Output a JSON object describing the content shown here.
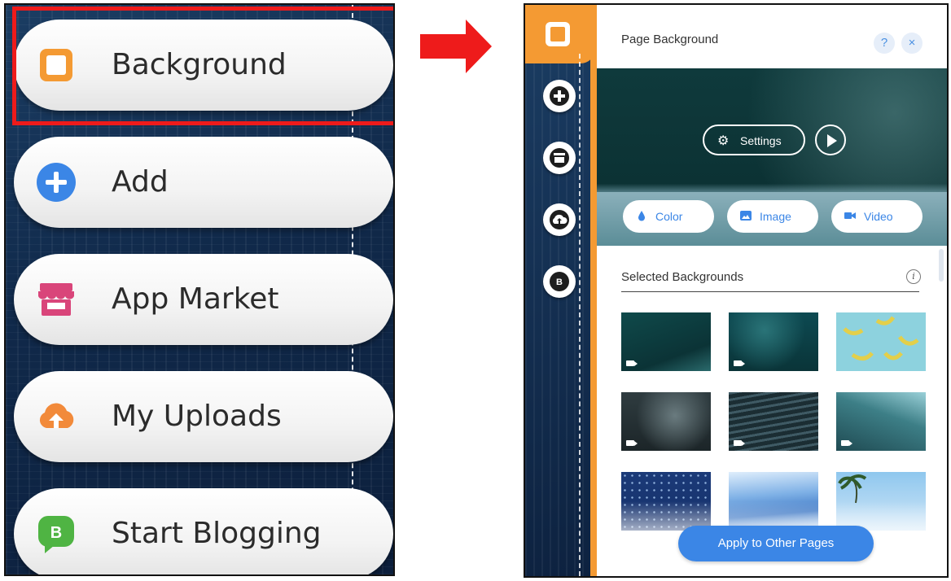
{
  "left_menu": {
    "items": [
      {
        "label": "Background",
        "icon": "square-icon",
        "color": "#f49a33"
      },
      {
        "label": "Add",
        "icon": "plus-circle-icon",
        "color": "#3b86e6"
      },
      {
        "label": "App Market",
        "icon": "store-icon",
        "color": "#d9457a"
      },
      {
        "label": "My Uploads",
        "icon": "cloud-upload-icon",
        "color": "#f28a3a"
      },
      {
        "label": "Start Blogging",
        "icon": "blog-bubble-icon",
        "color": "#4fb443",
        "icon_text": "B"
      }
    ],
    "highlight_color": "#ee1b1b"
  },
  "arrow_color": "#ee1b1b",
  "panel": {
    "title": "Page Background",
    "help_label": "?",
    "close_label": "×",
    "settings_label": "Settings",
    "media_buttons": [
      {
        "label": "Color",
        "icon": "drop-icon"
      },
      {
        "label": "Image",
        "icon": "image-icon"
      },
      {
        "label": "Video",
        "icon": "video-icon"
      }
    ],
    "selected_title": "Selected Backgrounds",
    "info_label": "i",
    "apply_label": "Apply to Other Pages",
    "rail_blog_text": "B",
    "accent": "#3b86e6",
    "thumbs": [
      {
        "name": "teal-ocean-video",
        "video": true
      },
      {
        "name": "teal-particles-video",
        "video": true
      },
      {
        "name": "bananas-image",
        "video": false
      },
      {
        "name": "dark-water-video",
        "video": true
      },
      {
        "name": "dark-waves-video",
        "video": true
      },
      {
        "name": "underwater-video",
        "video": true
      },
      {
        "name": "navy-dots-image",
        "video": false
      },
      {
        "name": "blue-wave-image",
        "video": false
      },
      {
        "name": "palm-beach-image",
        "video": false
      }
    ]
  }
}
